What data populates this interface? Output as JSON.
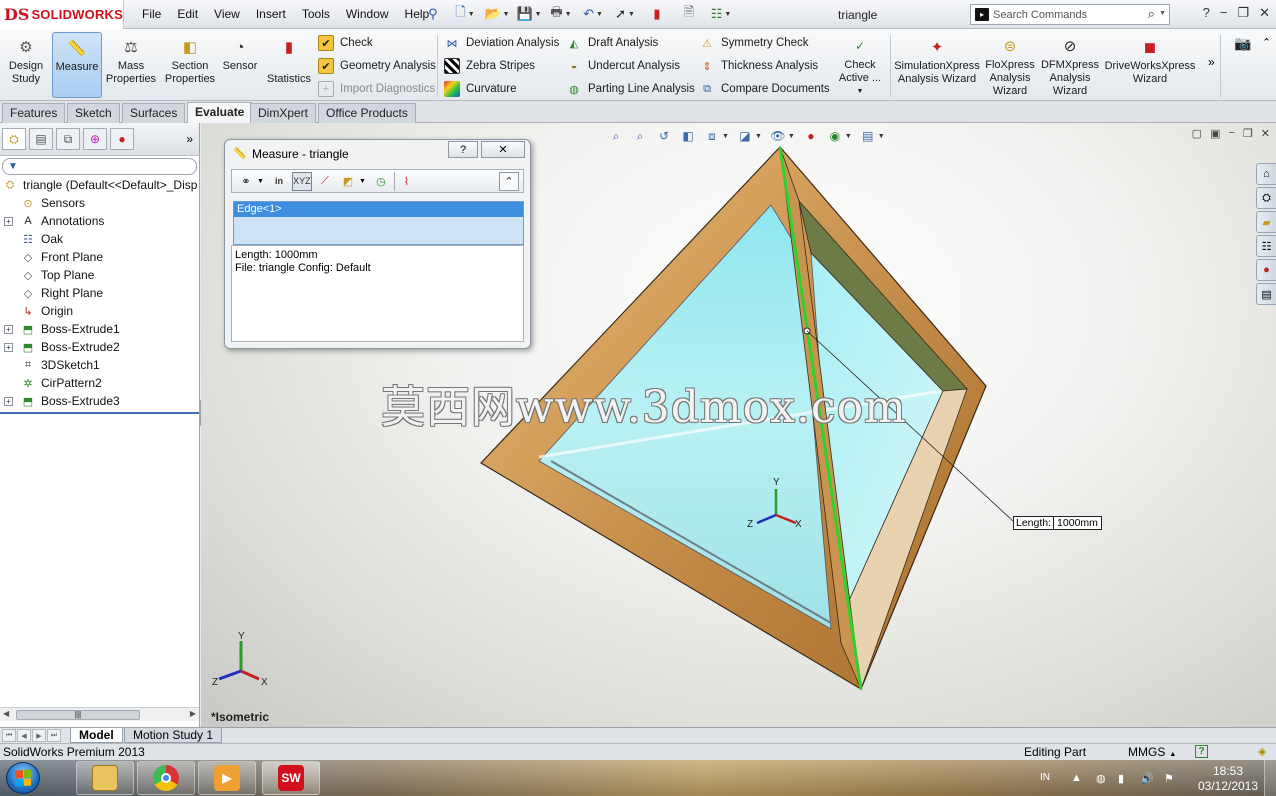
{
  "app": {
    "logo_mark": "DS",
    "logo_name": "SOLIDWORKS",
    "doc_title": "triangle",
    "menu": [
      "File",
      "Edit",
      "View",
      "Insert",
      "Tools",
      "Window",
      "Help"
    ],
    "search_placeholder": "Search Commands"
  },
  "commandmanager": {
    "big_buttons": [
      {
        "label": "Design\nStudy",
        "icon": "design-study-icon"
      },
      {
        "label": "Measure",
        "icon": "measure-icon",
        "active": true
      },
      {
        "label": "Mass\nProperties",
        "icon": "mass-properties-icon"
      },
      {
        "label": "Section\nProperties",
        "icon": "section-properties-icon"
      },
      {
        "label": "Sensor",
        "icon": "sensor-icon"
      },
      {
        "label": "Statistics",
        "icon": "statistics-icon"
      }
    ],
    "col1": [
      {
        "label": "Check",
        "icon": "check-icon"
      },
      {
        "label": "Geometry Analysis",
        "icon": "geometry-analysis-icon"
      },
      {
        "label": "Import Diagnostics",
        "icon": "import-diagnostics-icon",
        "disabled": true
      }
    ],
    "col2": [
      {
        "label": "Deviation Analysis",
        "icon": "deviation-analysis-icon"
      },
      {
        "label": "Zebra Stripes",
        "icon": "zebra-stripes-icon"
      },
      {
        "label": "Curvature",
        "icon": "curvature-icon"
      }
    ],
    "col3": [
      {
        "label": "Draft Analysis",
        "icon": "draft-analysis-icon"
      },
      {
        "label": "Undercut Analysis",
        "icon": "undercut-analysis-icon"
      },
      {
        "label": "Parting Line Analysis",
        "icon": "parting-line-analysis-icon"
      }
    ],
    "col4": [
      {
        "label": "Symmetry Check",
        "icon": "symmetry-check-icon"
      },
      {
        "label": "Thickness Analysis",
        "icon": "thickness-analysis-icon"
      },
      {
        "label": "Compare Documents",
        "icon": "compare-documents-icon"
      }
    ],
    "check_active": "Check\nActive ...",
    "wizards": [
      {
        "label": "SimulationXpress\nAnalysis Wizard"
      },
      {
        "label": "FloXpress\nAnalysis\nWizard"
      },
      {
        "label": "DFMXpress\nAnalysis\nWizard"
      },
      {
        "label": "DriveWorksXpress\nWizard"
      }
    ],
    "more": "»"
  },
  "tabs": [
    "Features",
    "Sketch",
    "Surfaces",
    "Evaluate",
    "DimXpert",
    "Office Products"
  ],
  "active_tab": "Evaluate",
  "feature_tree": {
    "root": "triangle  (Default<<Default>_Disp",
    "items": [
      {
        "label": "Sensors",
        "icon": "sensors-icon",
        "expandable": false
      },
      {
        "label": "Annotations",
        "icon": "annotations-icon",
        "expandable": true
      },
      {
        "label": "Oak",
        "icon": "material-icon",
        "expandable": false
      },
      {
        "label": "Front Plane",
        "icon": "plane-icon",
        "expandable": false
      },
      {
        "label": "Top Plane",
        "icon": "plane-icon",
        "expandable": false
      },
      {
        "label": "Right Plane",
        "icon": "plane-icon",
        "expandable": false
      },
      {
        "label": "Origin",
        "icon": "origin-icon",
        "expandable": false
      },
      {
        "label": "Boss-Extrude1",
        "icon": "extrude-icon",
        "expandable": true
      },
      {
        "label": "Boss-Extrude2",
        "icon": "extrude-icon",
        "expandable": true
      },
      {
        "label": "3DSketch1",
        "icon": "3dsketch-icon",
        "expandable": false
      },
      {
        "label": "CirPattern2",
        "icon": "circular-pattern-icon",
        "expandable": false
      },
      {
        "label": "Boss-Extrude3",
        "icon": "extrude-icon",
        "expandable": true
      }
    ]
  },
  "measure_dialog": {
    "title": "Measure - triangle",
    "help": "?",
    "close": "✕",
    "collapse": "⌃",
    "selection": "Edge<1>",
    "results": [
      "Length: 1000mm",
      "File: triangle Config: Default"
    ]
  },
  "graphics": {
    "view_label": "*Isometric",
    "watermark": "莫西网www.3dmox.com",
    "callout_label": "Length:",
    "callout_value": "1000mm",
    "axis_x": "X",
    "axis_y": "Y",
    "axis_z": "Z"
  },
  "bottom_tabs": [
    "Model",
    "Motion Study 1"
  ],
  "active_bottom_tab": "Model",
  "status": {
    "product": "SolidWorks Premium 2013",
    "mode": "Editing Part",
    "units": "MMGS"
  },
  "taskbar": {
    "lang": "IN",
    "time": "18:53",
    "date": "03/12/2013",
    "sw_label": "SW"
  },
  "colors": {
    "accent": "#3d8ee0",
    "edge_highlight": "#2fd12f",
    "wood": "#c8924a",
    "glass": "#a9eaf0"
  }
}
